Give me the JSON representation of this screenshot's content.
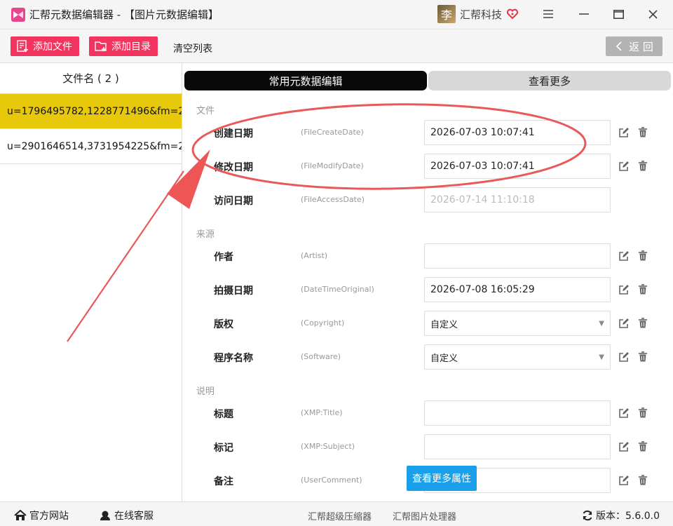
{
  "window": {
    "title": "汇帮元数据编辑器 - 【图片元数据编辑】",
    "brand_avatar_char": "李",
    "brand_name": "汇帮科技"
  },
  "toolbar": {
    "add_file": "添加文件",
    "add_dir": "添加目录",
    "clear_list": "清空列表",
    "back": "返 回"
  },
  "filelist": {
    "header": "文件名 ( 2 )",
    "items": [
      "u=1796495782,1228771496&fm=2...",
      "u=2901646514,3731954225&fm=2..."
    ]
  },
  "tabs": {
    "common": "常用元数据编辑",
    "more": "查看更多"
  },
  "sections": {
    "file": "文件",
    "source": "来源",
    "desc": "说明"
  },
  "fields": {
    "create": {
      "label": "创建日期",
      "key": "(FileCreateDate)",
      "value": "2026-07-03 10:07:41"
    },
    "modify": {
      "label": "修改日期",
      "key": "(FileModifyDate)",
      "value": "2026-07-03 10:07:41"
    },
    "access": {
      "label": "访问日期",
      "key": "(FileAccessDate)",
      "value": "2026-07-14 11:10:18"
    },
    "artist": {
      "label": "作者",
      "key": "(Artist)",
      "value": ""
    },
    "shoot": {
      "label": "拍摄日期",
      "key": "(DateTimeOriginal)",
      "value": "2026-07-08 16:05:29"
    },
    "copyright": {
      "label": "版权",
      "key": "(Copyright)",
      "value": "自定义"
    },
    "software": {
      "label": "程序名称",
      "key": "(Software)",
      "value": "自定义"
    },
    "title": {
      "label": "标题",
      "key": "(XMP:Title)",
      "value": ""
    },
    "subject": {
      "label": "标记",
      "key": "(XMP:Subject)",
      "value": ""
    },
    "comment": {
      "label": "备注",
      "key": "(UserComment)",
      "value": ""
    }
  },
  "more_props": "查看更多属性",
  "statusbar": {
    "website": "官方网站",
    "service": "在线客服",
    "compressor": "汇帮超级压缩器",
    "processor": "汇帮图片处理器",
    "version": "版本：5.6.0.0"
  },
  "colors": {
    "accent": "#f3345e",
    "selected_row": "#e8c80a",
    "annotation_red": "#e85a5a",
    "more_button": "#1aa0ea"
  }
}
